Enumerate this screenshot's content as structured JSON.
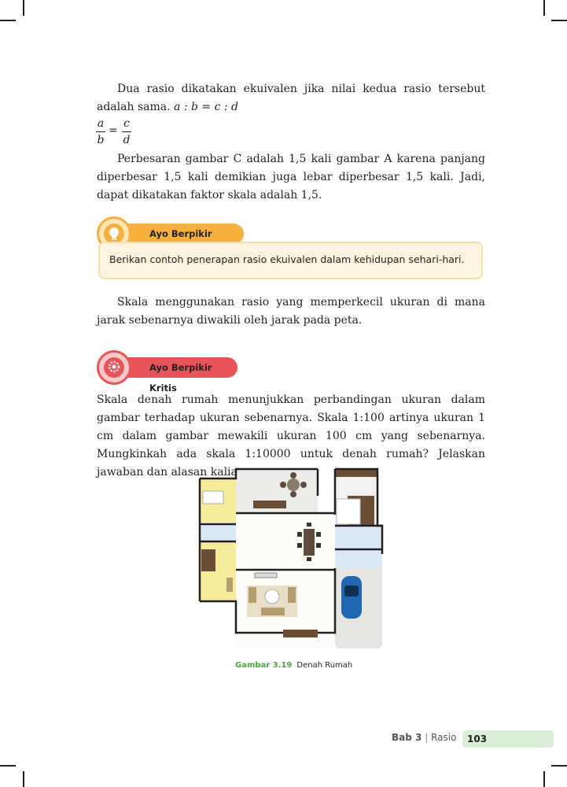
{
  "paragraphs": {
    "p1_text": "Dua rasio dikatakan ekuivalen jika nilai kedua rasio tersebut adalah sama.",
    "p1_math": "a : b = c : d",
    "frac_left_num": "a",
    "frac_left_den": "b",
    "frac_eq": "=",
    "frac_right_num": "c",
    "frac_right_den": "d",
    "p2": "Perbesaran gambar C adalah 1,5 kali gambar A karena panjang diperbesar 1,5 kali demikian juga lebar diperbesar 1,5 kali. Jadi, dapat dikatakan faktor skala adalah 1,5.",
    "p3": "Skala menggunakan rasio yang memperkecil ukuran di mana jarak sebenarnya diwakili oleh jarak pada peta.",
    "p4": "Skala denah rumah menunjukkan perbandingan ukuran dalam gambar terhadap ukuran sebenarnya. Skala 1:100 artinya ukuran 1 cm dalam gambar mewakili ukuran 100 cm yang sebenarnya. Mungkinkah ada skala 1:10000 untuk denah rumah? Jelaskan jawaban dan alasan kalian."
  },
  "kreatif": {
    "title": "Ayo Berpikir Kreatif",
    "prompt": "Berikan contoh penerapan rasio ekuivalen dalam kehidupan sehari-hari.",
    "icon": "lightbulb-icon",
    "color": "#f6b13d"
  },
  "kritis": {
    "title": "Ayo Berpikir Kritis",
    "icon": "gear-head-icon",
    "color": "#e8545a"
  },
  "figure": {
    "label": "Gambar 3.19",
    "title": "Denah Rumah"
  },
  "footer": {
    "chapter": "Bab 3",
    "separator": "|",
    "topic": "Rasio",
    "page": "103"
  }
}
